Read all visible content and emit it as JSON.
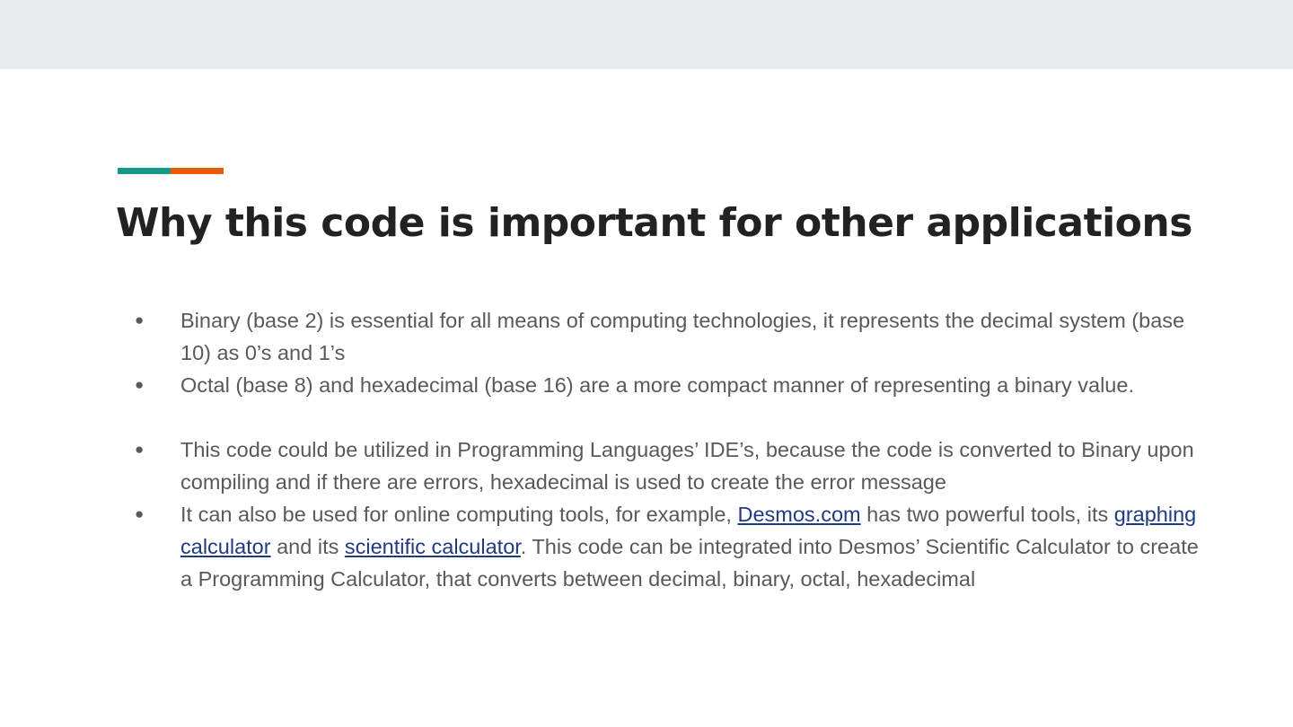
{
  "colors": {
    "top_band": "#e8ebec",
    "accent_teal": "#17968a",
    "accent_orange": "#e8590c",
    "title": "#222222",
    "body_text": "#595959",
    "link": "#1f3a82"
  },
  "slide": {
    "title": "Why this code is important for other applications",
    "bullet_symbol": "●",
    "bullets": [
      {
        "text": "Binary (base 2) is essential for all means of computing technologies, it represents the decimal system (base 10)  as 0’s and 1’s"
      },
      {
        "text": "Octal (base 8) and hexadecimal (base 16) are a more compact manner of representing a binary value."
      },
      {
        "text": "This code could be utilized in Programming Languages’ IDE’s, because the code is converted to Binary upon compiling and if there are errors, hexadecimal is used to create the error message"
      },
      {
        "part1": "It can also be used for online computing tools, for example, ",
        "link1": "Desmos.com",
        "part2": " has two powerful tools, its ",
        "link2": "graphing calculator",
        "part3": " and its ",
        "link3": "scientific calculator",
        "part4": ". This code can be integrated into Desmos’ Scientific Calculator to create a Programming Calculator, that converts between decimal, binary, octal, hexadecimal"
      }
    ]
  }
}
